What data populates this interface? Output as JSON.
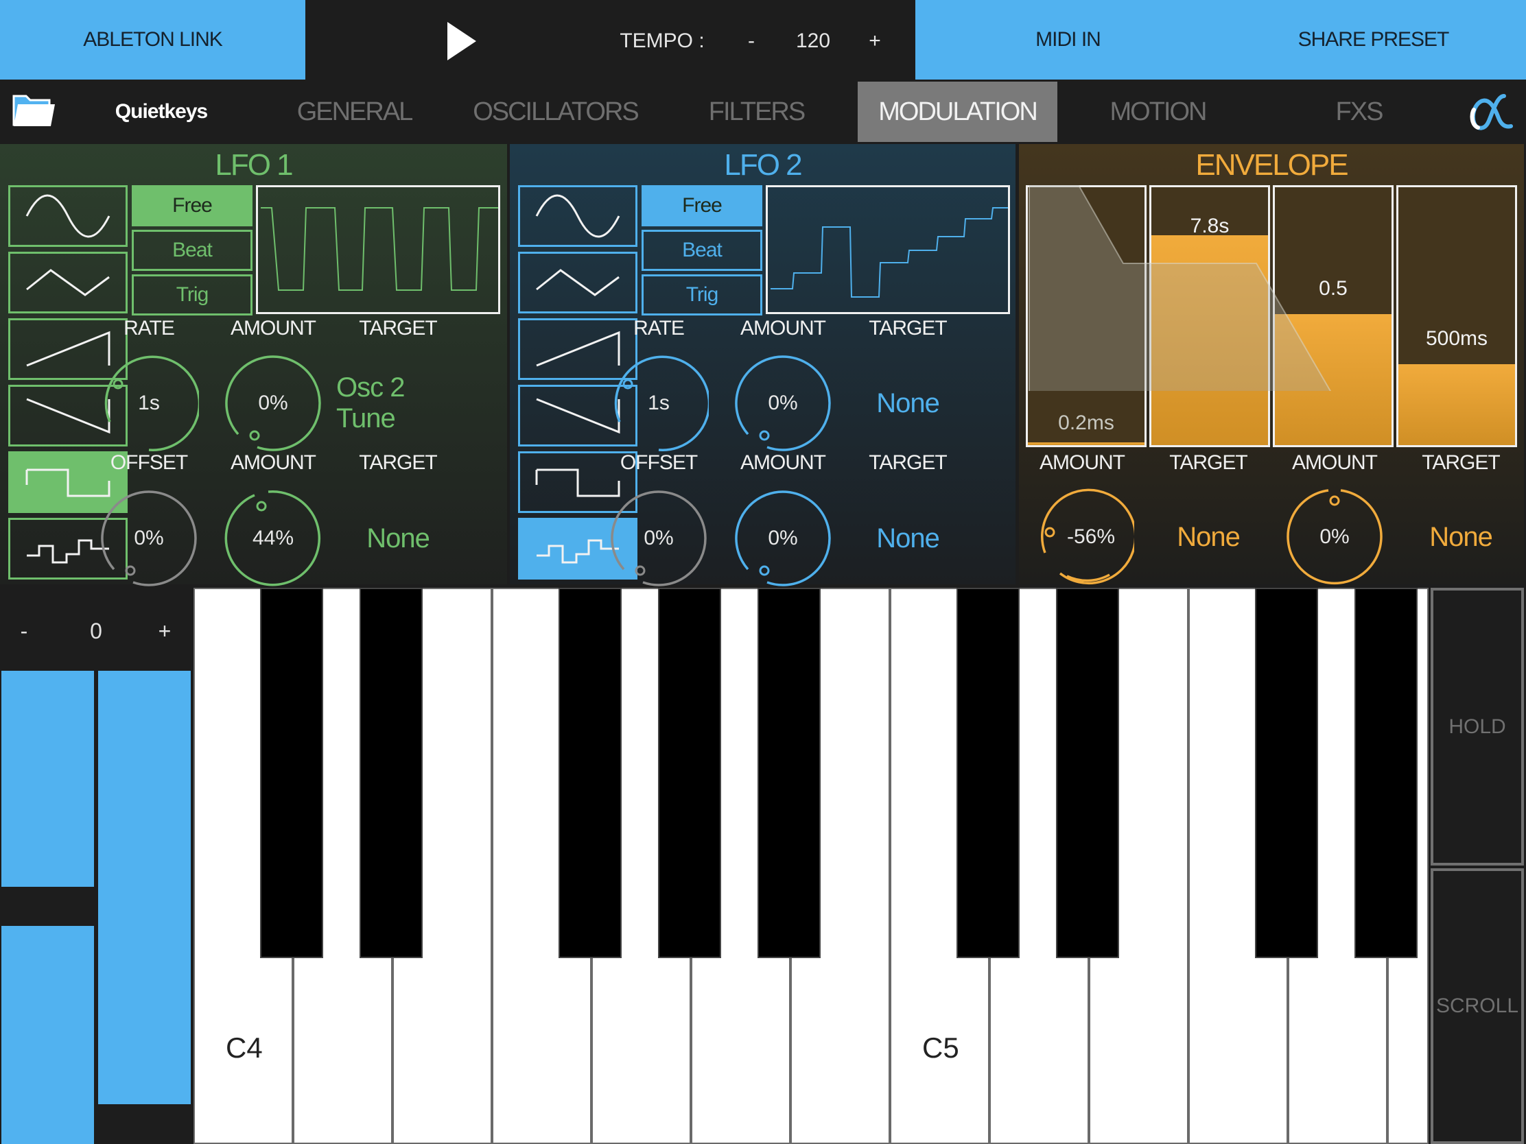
{
  "topbar": {
    "ableton_link": "ABLETON LINK",
    "tempo_label": "TEMPO :",
    "tempo_minus": "-",
    "tempo_value": "120",
    "tempo_plus": "+",
    "midi_in": "MIDI IN",
    "share_preset": "SHARE PRESET",
    "play_icon": "play-icon"
  },
  "nav": {
    "folder_icon": "folder-icon",
    "preset_name": "Quietkeys",
    "tabs": [
      {
        "label": "GENERAL",
        "active": false
      },
      {
        "label": "OSCILLATORS",
        "active": false
      },
      {
        "label": "FILTERS",
        "active": false
      },
      {
        "label": "MODULATION",
        "active": true
      },
      {
        "label": "MOTION",
        "active": false
      },
      {
        "label": "FXS",
        "active": false
      }
    ],
    "logo_icon": "alpha-logo-icon"
  },
  "colors": {
    "accent_blue": "#51b2f0",
    "lfo1_green": "#6fbf6c",
    "lfo2_blue": "#4fb0ec",
    "envelope_orange": "#f1ab3c"
  },
  "lfo1": {
    "title": "LFO 1",
    "waveforms": [
      "sine",
      "triangle",
      "saw-up",
      "saw-down",
      "square",
      "random-step"
    ],
    "selected_waveform": "square",
    "modes": [
      "Free",
      "Beat",
      "Trig"
    ],
    "selected_mode": "Free",
    "row1_labels": [
      "RATE",
      "AMOUNT",
      "TARGET"
    ],
    "rate": "1s",
    "amount1": "0%",
    "target1": "Osc 2 Tune",
    "row2_labels": [
      "OFFSET",
      "AMOUNT",
      "TARGET"
    ],
    "offset": "0%",
    "amount2": "44%",
    "target2": "None"
  },
  "lfo2": {
    "title": "LFO 2",
    "waveforms": [
      "sine",
      "triangle",
      "saw-up",
      "saw-down",
      "square",
      "random-step"
    ],
    "selected_waveform": "random-step",
    "modes": [
      "Free",
      "Beat",
      "Trig"
    ],
    "selected_mode": "Free",
    "row1_labels": [
      "RATE",
      "AMOUNT",
      "TARGET"
    ],
    "rate": "1s",
    "amount1": "0%",
    "target1": "None",
    "row2_labels": [
      "OFFSET",
      "AMOUNT",
      "TARGET"
    ],
    "offset": "0%",
    "amount2": "0%",
    "target2": "None"
  },
  "envelope": {
    "title": "ENVELOPE",
    "bars": [
      {
        "name": "attack",
        "value": "0.2ms",
        "level": 0.01
      },
      {
        "name": "decay",
        "value": "7.8s",
        "level": 0.8
      },
      {
        "name": "sustain",
        "value": "0.5",
        "level": 0.5
      },
      {
        "name": "release",
        "value": "500ms",
        "level": 0.31
      }
    ],
    "labels": [
      "AMOUNT",
      "TARGET",
      "AMOUNT",
      "TARGET"
    ],
    "amount1": "-56%",
    "target1": "None",
    "amount2": "0%",
    "target2": "None"
  },
  "keyboard": {
    "octave_minus": "-",
    "octave_value": "0",
    "octave_plus": "+",
    "key_labels": {
      "c4": "C4",
      "c5": "C5"
    },
    "hold": "HOLD",
    "scroll": "SCROLL"
  }
}
